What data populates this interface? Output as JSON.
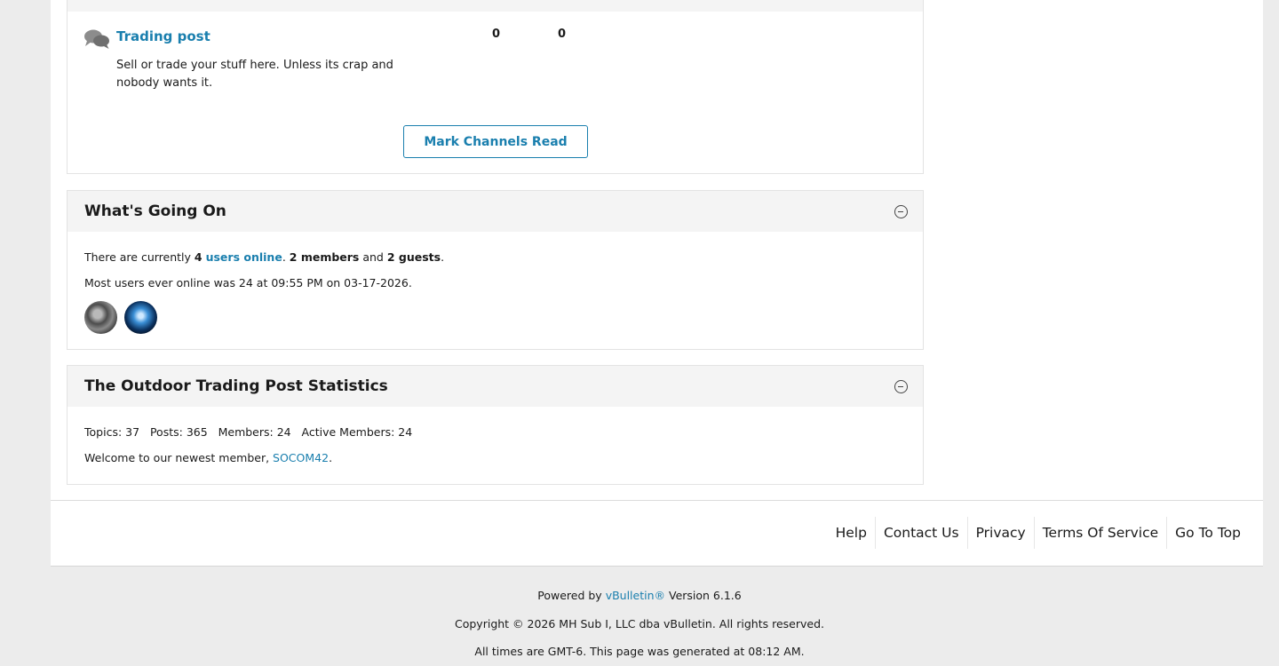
{
  "forum": {
    "title": "Trading post",
    "description": "Sell or trade your stuff here. Unless its crap and nobody wants it.",
    "topics": "0",
    "posts": "0",
    "mark_read_label": "Mark Channels Read"
  },
  "whats_going_on": {
    "title": "What's Going On",
    "line1_prefix": "There are currently ",
    "online_count": "4",
    "online_link": "users online",
    "dot1": ". ",
    "members_count": "2 members",
    "and_text": " and ",
    "guests_count": "2 guests",
    "dot2": ".",
    "line2": "Most users ever online was 24 at 09:55 PM on 03-17-2026."
  },
  "statistics": {
    "title": "The Outdoor Trading Post Statistics",
    "line1": "Topics: 37   Posts: 365   Members: 24   Active Members: 24",
    "welcome_prefix": "Welcome to our newest member, ",
    "newest_member": "SOCOM42",
    "welcome_suffix": "."
  },
  "footer_nav": [
    "Help",
    "Contact Us",
    "Privacy",
    "Terms Of Service",
    "Go To Top"
  ],
  "credits": {
    "powered_prefix": "Powered by ",
    "powered_link": "vBulletin®",
    "powered_suffix": " Version 6.1.6",
    "copyright": "Copyright © 2026 MH Sub I, LLC dba vBulletin. All rights reserved.",
    "times": "All times are GMT-6. This page was generated at 08:12 AM."
  },
  "colors": {
    "link": "#1a7fae",
    "header_bg": "#f4f4f4",
    "page_bg": "#ececec"
  }
}
